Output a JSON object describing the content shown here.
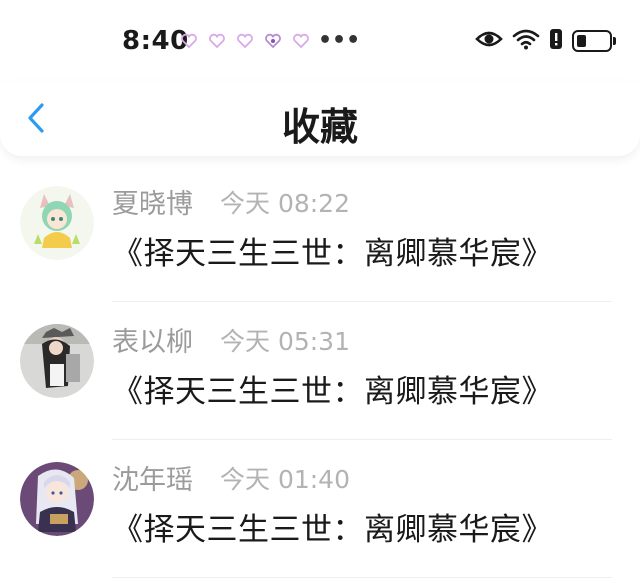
{
  "status_bar": {
    "time": "8:40",
    "more": "•••",
    "hearts": [
      "heart-icon",
      "heart-icon",
      "heart-icon",
      "heart-icon",
      "heart-icon"
    ],
    "icons": [
      "eye-icon",
      "wifi-icon",
      "alert-icon",
      "battery-icon"
    ],
    "battery_level": 0.3
  },
  "header": {
    "title": "收藏",
    "back_icon": "chevron-left-icon",
    "accent_color": "#2d9cf0"
  },
  "favorites": [
    {
      "sender": "夏晓博",
      "time": "今天 08:22",
      "message": "《择天三生三世：离卿慕华宸》"
    },
    {
      "sender": "表以柳",
      "time": "今天 05:31",
      "message": "《择天三生三世：离卿慕华宸》"
    },
    {
      "sender": "沈年瑶",
      "time": "今天 01:40",
      "message": "《择天三生三世：离卿慕华宸》"
    }
  ]
}
